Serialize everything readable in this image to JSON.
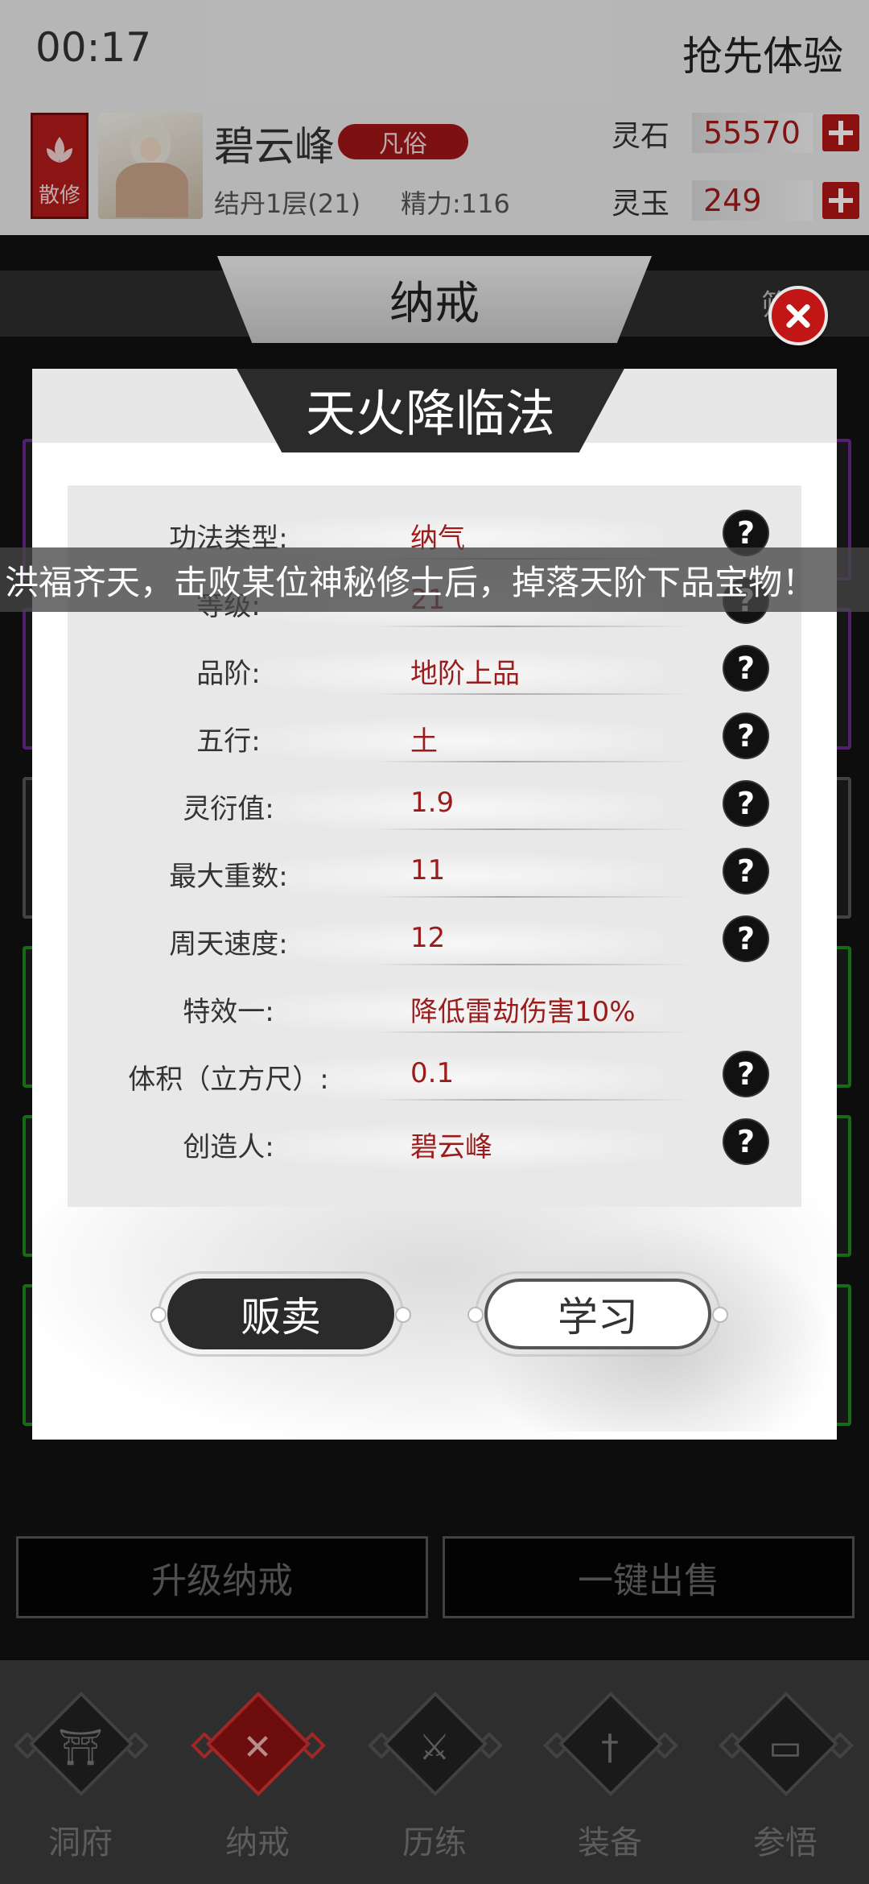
{
  "status_bar": {
    "time": "00:17",
    "promo": "抢先体验"
  },
  "player": {
    "sect_badge": "散修",
    "name": "碧云峰",
    "rank": "凡俗",
    "realm": "结丹1层(21)",
    "energy": "精力:116"
  },
  "currencies": [
    {
      "label": "灵石",
      "value": "55570"
    },
    {
      "label": "灵玉",
      "value": "249"
    }
  ],
  "panel": {
    "tab_title": "纳戒",
    "filter_label": "筛"
  },
  "modal": {
    "title": "天火降临法",
    "attributes": [
      {
        "label": "功法类型:",
        "value": "纳气",
        "help": true
      },
      {
        "label": "等级:",
        "value": "21",
        "help": true
      },
      {
        "label": "品阶:",
        "value": "地阶上品",
        "help": true
      },
      {
        "label": "五行:",
        "value": "土",
        "help": true
      },
      {
        "label": "灵衍值:",
        "value": "1.9",
        "help": true
      },
      {
        "label": "最大重数:",
        "value": "11",
        "help": true
      },
      {
        "label": "周天速度:",
        "value": "12",
        "help": true
      },
      {
        "label": "特效一:",
        "value": "降低雷劫伤害10%",
        "help": false
      },
      {
        "label": "体积（立方尺）:",
        "value": "0.1",
        "help": true
      },
      {
        "label": "创造人:",
        "value": "碧云峰",
        "help": true
      }
    ],
    "help_glyph": "?",
    "sell_label": "贩卖",
    "learn_label": "学习"
  },
  "ticker": "洪福齐天，击败某位神秘修士后，掉落天阶下品宝物！",
  "bottom_buttons": {
    "upgrade": "升级纳戒",
    "sell_all": "一键出售"
  },
  "nav": [
    {
      "label": "洞府",
      "icon": "gate-icon",
      "glyph": "⛩"
    },
    {
      "label": "纳戒",
      "icon": "ring-x-icon",
      "glyph": "✕"
    },
    {
      "label": "历练",
      "icon": "crossed-swords-icon",
      "glyph": "⚔"
    },
    {
      "label": "装备",
      "icon": "sword-icon",
      "glyph": "†"
    },
    {
      "label": "参悟",
      "icon": "book-icon",
      "glyph": "▭"
    }
  ],
  "colors": {
    "accent_red": "#b31b1b",
    "value_red": "#9b1c1c",
    "dark": "#2b2b2b"
  }
}
